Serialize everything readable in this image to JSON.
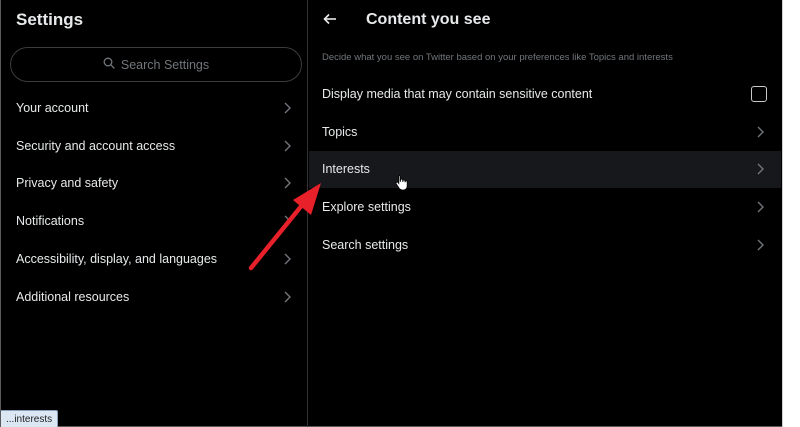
{
  "sidebar": {
    "title": "Settings",
    "search_placeholder": "Search Settings",
    "items": [
      {
        "label": "Your account"
      },
      {
        "label": "Security and account access"
      },
      {
        "label": "Privacy and safety"
      },
      {
        "label": "Notifications"
      },
      {
        "label": "Accessibility, display, and languages"
      },
      {
        "label": "Additional resources"
      }
    ]
  },
  "main": {
    "title": "Content you see",
    "subtitle": "Decide what you see on Twitter based on your preferences like Topics and interests",
    "sensitive_toggle_label": "Display media that may contain sensitive content",
    "sensitive_checked": false,
    "rows": [
      {
        "label": "Topics"
      },
      {
        "label": "Interests"
      },
      {
        "label": "Explore settings"
      },
      {
        "label": "Search settings"
      }
    ]
  },
  "status_bar": {
    "link_text": "...interests"
  },
  "colors": {
    "background": "#000000",
    "text_primary": "#e7e9ea",
    "text_secondary": "#71767b",
    "divider": "#2f3336",
    "hover_row": "#16181c",
    "annotation_arrow": "#e8202a"
  }
}
